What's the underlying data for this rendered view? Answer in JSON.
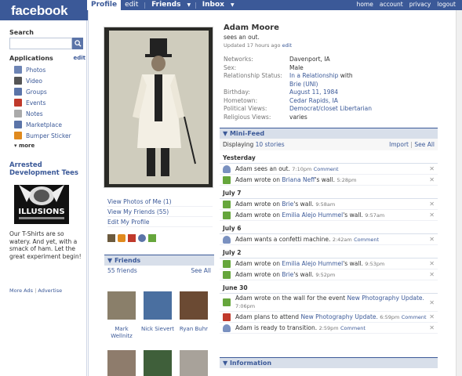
{
  "brand": {
    "logo": "facebook"
  },
  "topnav": {
    "profile": "Profile",
    "edit": "edit",
    "friends": "Friends",
    "inbox": "Inbox",
    "links": [
      "home",
      "account",
      "privacy",
      "logout"
    ]
  },
  "sidebar": {
    "search_title": "Search",
    "apps_title": "Applications",
    "apps_edit": "edit",
    "apps": [
      {
        "label": "Photos",
        "icon": "photos-icon",
        "color": "#6d84b4"
      },
      {
        "label": "Video",
        "icon": "video-icon",
        "color": "#555"
      },
      {
        "label": "Groups",
        "icon": "groups-icon",
        "color": "#5b74a8"
      },
      {
        "label": "Events",
        "icon": "events-icon",
        "color": "#c0392b"
      },
      {
        "label": "Notes",
        "icon": "notes-icon",
        "color": "#aaa"
      },
      {
        "label": "Marketplace",
        "icon": "marketplace-icon",
        "color": "#5b74a8"
      },
      {
        "label": "Bumper Sticker",
        "icon": "bumper-sticker-icon",
        "color": "#e08a1e"
      }
    ],
    "more": "▾ more",
    "ad_title": "Arrested Development Tees",
    "ad_image_text": "ILLUSIONS",
    "ad_text": "Our T-Shirts are so watery. And yet, with a smack of ham. Let the great experiment begin!",
    "ad_links": [
      "More Ads",
      "Advertise"
    ]
  },
  "profile": {
    "name": "Adam Moore",
    "status": "sees an out.",
    "updated": "Updated 17 hours ago",
    "updated_edit": "edit",
    "info": [
      {
        "k": "Networks:",
        "v": "Davenport, IA",
        "plain": true
      },
      {
        "k": "Sex:",
        "v": "Male",
        "plain": true
      },
      {
        "k": "Relationship Status:",
        "v": "In a Relationship",
        "v2": " with",
        "v3": "Brie (UNI)"
      },
      {
        "k": "Birthday:",
        "v": "August 11, 1984"
      },
      {
        "k": "Hometown:",
        "v": "Cedar Rapids, IA"
      },
      {
        "k": "Political Views:",
        "v": "Democrat/closet Libertarian"
      },
      {
        "k": "Religious Views:",
        "v": "varies",
        "plain": true
      }
    ],
    "left_links": [
      "View Photos of Me (1)",
      "View My Friends (55)",
      "Edit My Profile"
    ]
  },
  "friends": {
    "title": "Friends",
    "count": "55 friends",
    "see_all": "See All",
    "list": [
      {
        "name": "Mark Wellnitz",
        "color": "#8a7f6a"
      },
      {
        "name": "Nick Sievert",
        "color": "#4a6fa0"
      },
      {
        "name": "Ryan Buhr",
        "color": "#6b4a33"
      },
      {
        "name": "",
        "color": "#8e7c6c"
      },
      {
        "name": "",
        "color": "#3f5f3a"
      },
      {
        "name": "",
        "color": "#a8a29a"
      }
    ]
  },
  "minifeed": {
    "title": "Mini-Feed",
    "displaying": "Displaying",
    "count": "10 stories",
    "import": "Import",
    "see_all": "See All",
    "days": [
      {
        "day": "Yesterday",
        "stories": [
          {
            "type": "status",
            "pre": "Adam sees an out.",
            "time": "7:10pm",
            "comment": "Comment"
          },
          {
            "type": "wall",
            "pre": "Adam wrote on ",
            "link": "Briana Neff",
            "post": "'s wall.",
            "time": "5:28pm"
          }
        ]
      },
      {
        "day": "July 7",
        "stories": [
          {
            "type": "wall",
            "pre": "Adam wrote on ",
            "link": "Brie",
            "post": "'s wall.",
            "time": "9:58am"
          },
          {
            "type": "wall",
            "pre": "Adam wrote on ",
            "link": "Emilia Alejo Hummel",
            "post": "'s wall.",
            "time": "9:57am"
          }
        ]
      },
      {
        "day": "July 6",
        "stories": [
          {
            "type": "status",
            "pre": "Adam wants a confetti machine.",
            "time": "2:42am",
            "comment": "Comment"
          }
        ]
      },
      {
        "day": "July 2",
        "stories": [
          {
            "type": "wall",
            "pre": "Adam wrote on ",
            "link": "Emilia Alejo Hummel",
            "post": "'s wall.",
            "time": "9:53pm"
          },
          {
            "type": "wall",
            "pre": "Adam wrote on ",
            "link": "Brie",
            "post": "'s wall.",
            "time": "9:52pm"
          }
        ]
      },
      {
        "day": "June 30",
        "stories": [
          {
            "type": "wall",
            "pre": "Adam wrote on the wall for the event ",
            "link": "New Photography Update.",
            "post": "",
            "time": "7:06pm"
          },
          {
            "type": "event",
            "pre": "Adam plans to attend ",
            "link": "New Photography Update.",
            "post": "",
            "time": "6:59pm",
            "comment": "Comment"
          },
          {
            "type": "status",
            "pre": "Adam is ready to transition.",
            "time": "2:59pm",
            "comment": "Comment"
          }
        ]
      }
    ]
  },
  "information": {
    "title": "Information"
  }
}
